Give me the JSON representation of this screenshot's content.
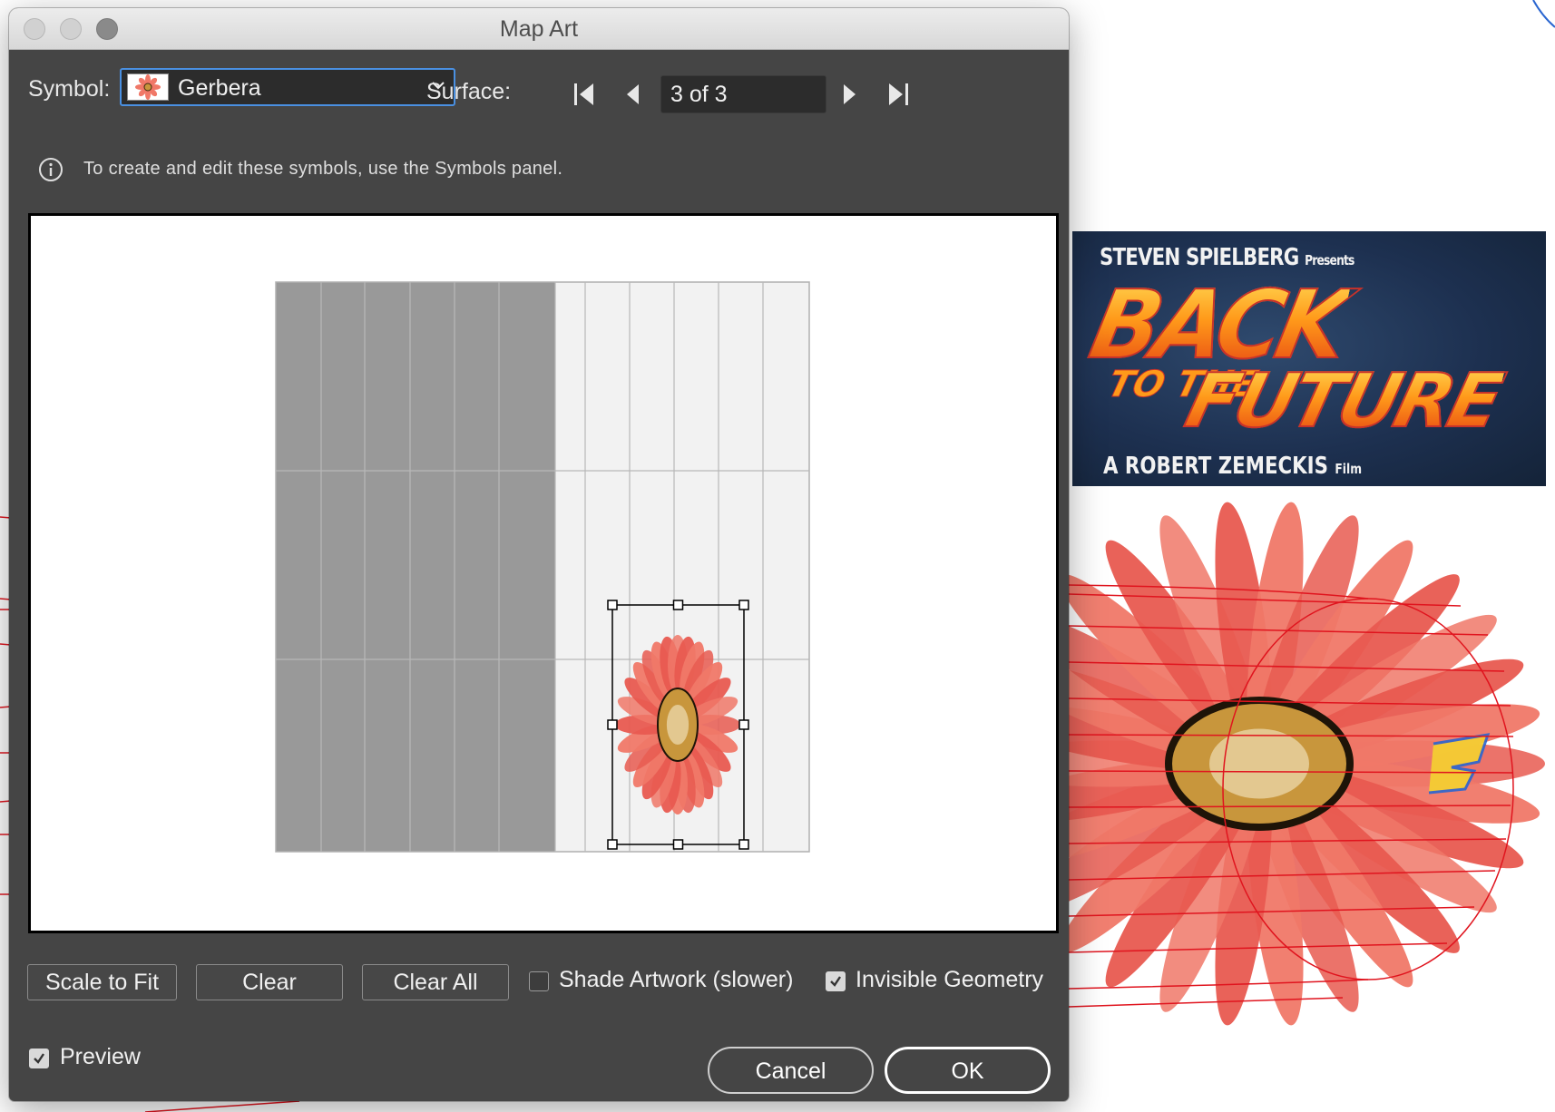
{
  "window": {
    "title": "Map Art"
  },
  "symbol": {
    "label": "Symbol:",
    "value": "Gerbera",
    "swatch_icon": "gerbera-thumbnail-icon"
  },
  "surface": {
    "label": "Surface:",
    "value": "3 of 3"
  },
  "info": {
    "text": "To create and edit these symbols, use the Symbols panel.",
    "icon": "info-icon"
  },
  "buttons": {
    "scale_to_fit": "Scale to Fit",
    "clear": "Clear",
    "clear_all": "Clear All"
  },
  "options": {
    "shade_artwork": {
      "label": "Shade Artwork (slower)",
      "checked": false
    },
    "invisible_geometry": {
      "label": "Invisible Geometry",
      "checked": true
    },
    "preview": {
      "label": "Preview",
      "checked": true
    }
  },
  "footer": {
    "cancel": "Cancel",
    "ok": "OK"
  },
  "background_poster": {
    "line1": "STEVEN SPIELBERG",
    "line1_small": "Presents",
    "title_big": "BACK",
    "title_to_the": "TO THE",
    "title_future": "FUTURE",
    "line3": "A ROBERT ZEMECKIS",
    "line3_small": "Film"
  },
  "colors": {
    "dialog_bg": "#454545",
    "focus_ring": "#4a90e2",
    "petal": "#f07868",
    "flower_center": "#c8963c",
    "guide_red": "#e0141e"
  }
}
